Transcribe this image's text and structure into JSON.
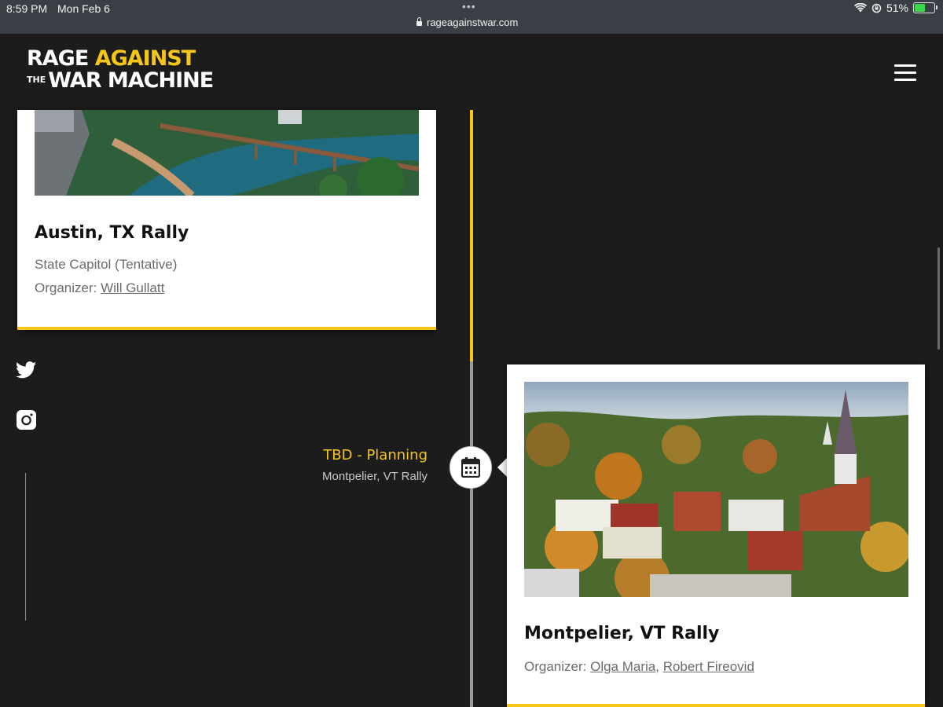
{
  "status_bar": {
    "time": "8:59 PM",
    "date": "Mon Feb 6",
    "dots": "•••",
    "url": "rageagainstwar.com",
    "battery": "51%",
    "battery_level": 0.51
  },
  "header": {
    "logo_line1_a": "RAGE",
    "logo_line1_b": "AGAINST",
    "logo_the": "THE",
    "logo_line2": "WAR MACHINE",
    "menu_icon": "hamburger-icon"
  },
  "cards": {
    "austin": {
      "title": "Austin, TX Rally",
      "location": "State Capitol (Tentative)",
      "organizer_label": "Organizer: ",
      "organizers": [
        "Will Gullatt"
      ]
    },
    "montpelier": {
      "title": "Montpelier, VT Rally",
      "organizer_label": "Organizer: ",
      "organizers": [
        "Olga Maria",
        "Robert Fireovid"
      ],
      "separator": ", "
    }
  },
  "timeline_event": {
    "date": "TBD - Planning",
    "name": "Montpelier, VT Rally",
    "icon": "calendar-icon"
  },
  "social": {
    "twitter_icon": "twitter-icon",
    "instagram_icon": "instagram-icon"
  },
  "colors": {
    "accent": "#f5c518",
    "background": "#1c1c1c",
    "statusbar": "#3a3f45"
  }
}
